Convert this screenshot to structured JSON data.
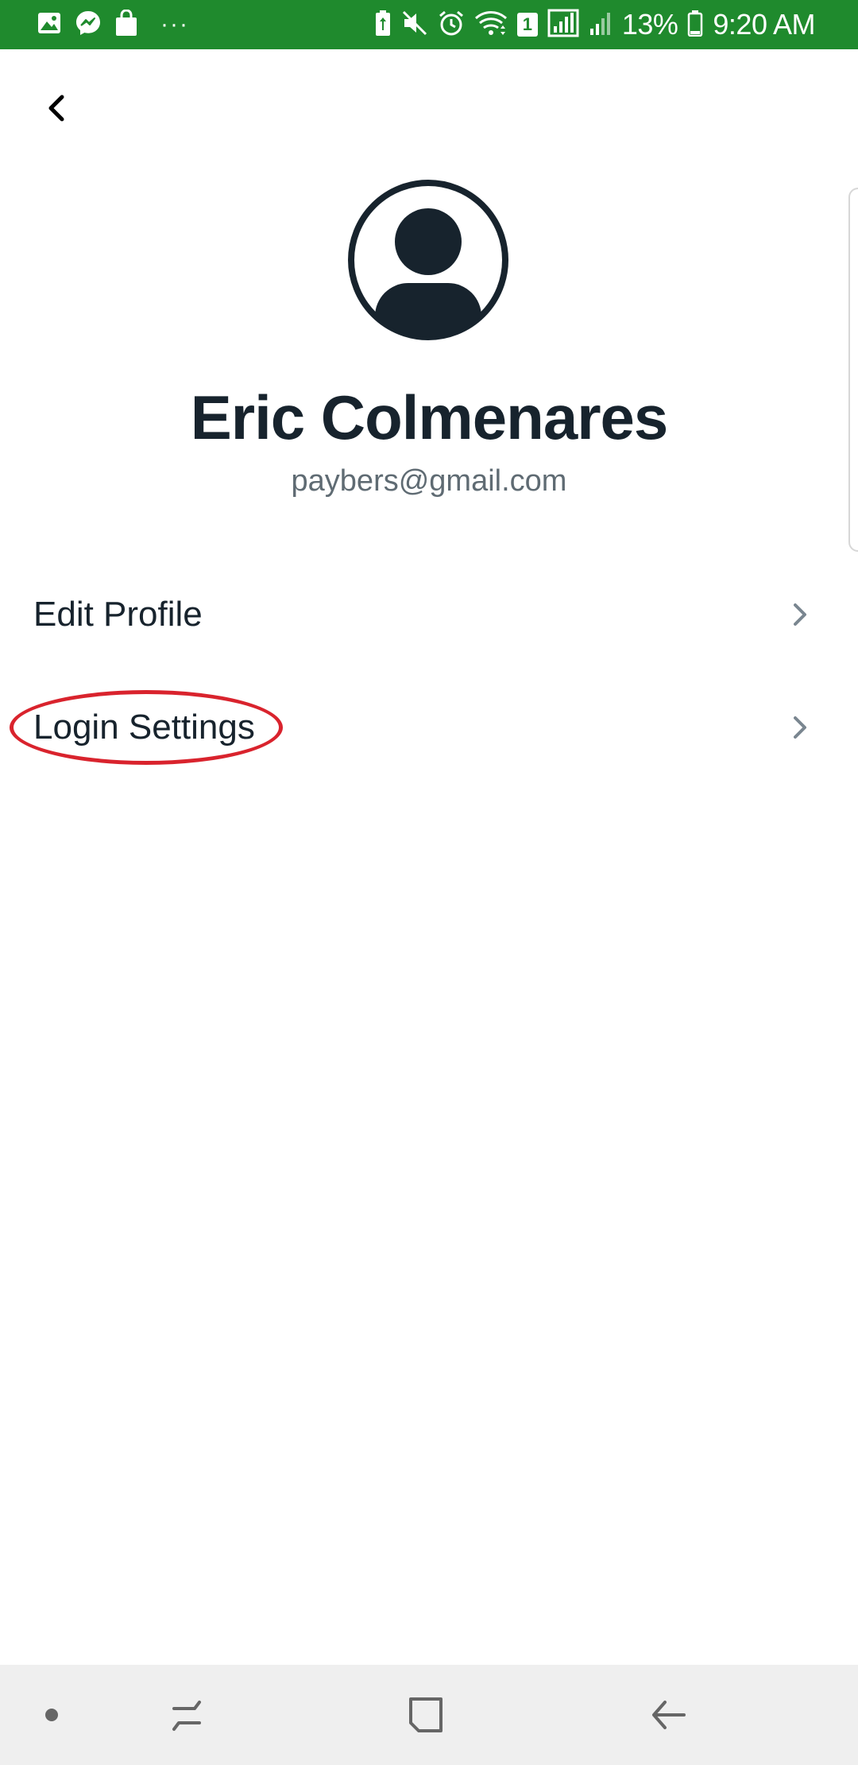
{
  "status_bar": {
    "battery_percent": "13%",
    "time": "9:20 AM",
    "sim_slot": "1",
    "more_glyph": "···",
    "background": "#1f8a2d",
    "left_icons": [
      "gallery-icon",
      "messenger-icon",
      "shopping-bag-icon",
      "more-notifications-icon"
    ],
    "right_icons": [
      "battery-saver-icon",
      "mute-icon",
      "alarm-icon",
      "wifi-icon",
      "sim-1-icon",
      "signal-icon",
      "signal-2-icon",
      "battery-icon"
    ]
  },
  "header": {
    "back_icon": "chevron-left-icon"
  },
  "profile": {
    "avatar_icon": "user-avatar-icon",
    "name": "Eric Colmenares",
    "email": "paybers@gmail.com"
  },
  "menu": {
    "items": [
      {
        "label": "Edit Profile",
        "icon": "chevron-right-icon"
      },
      {
        "label": "Login Settings",
        "icon": "chevron-right-icon",
        "highlighted": true
      }
    ]
  },
  "annotation": {
    "highlight_color": "#d9232d"
  },
  "nav_bar": {
    "buttons": [
      "nav-dot-icon",
      "recent-apps-icon",
      "home-icon",
      "back-icon"
    ]
  }
}
